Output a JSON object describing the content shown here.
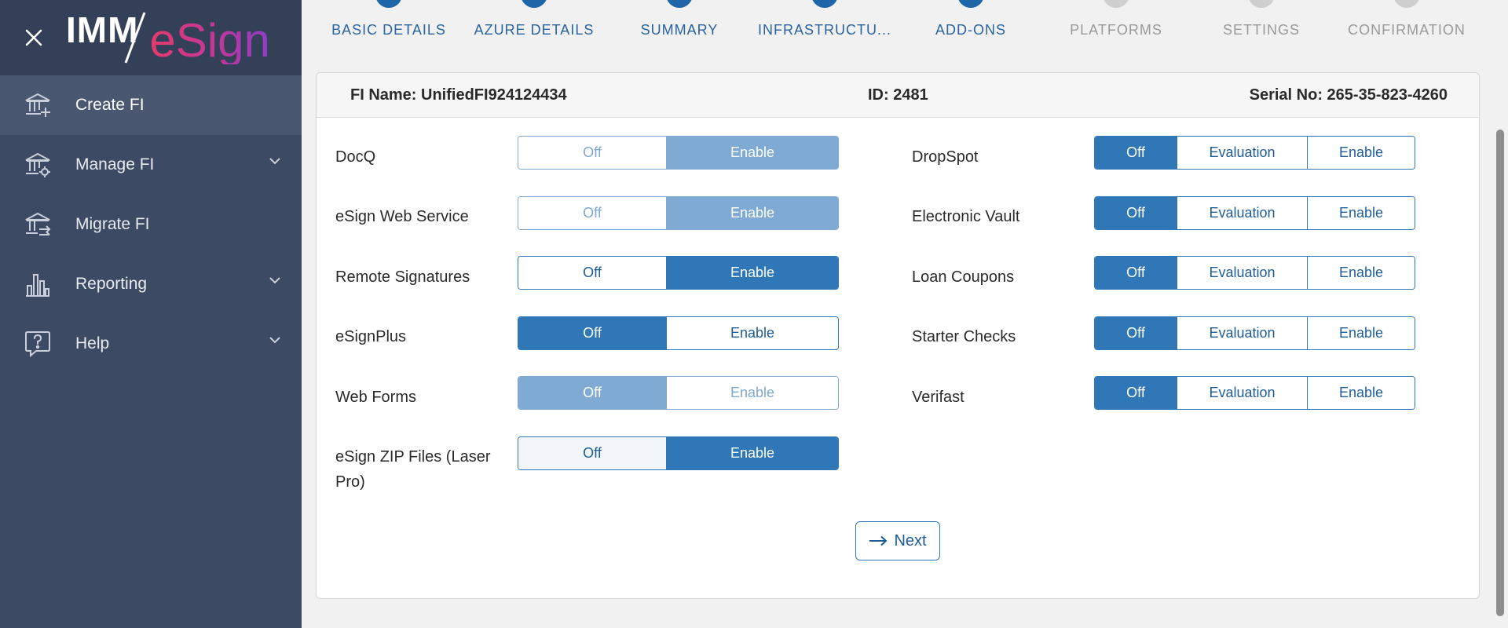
{
  "brand": {
    "logo_left": "IMM",
    "logo_right": "eSign"
  },
  "sidebar": {
    "items": [
      {
        "label": "Create FI",
        "icon": "bank-add-icon",
        "active": true
      },
      {
        "label": "Manage FI",
        "icon": "bank-settings-icon",
        "expandable": true
      },
      {
        "label": "Migrate FI",
        "icon": "bank-migrate-icon"
      },
      {
        "label": "Reporting",
        "icon": "bar-chart-icon",
        "expandable": true
      },
      {
        "label": "Help",
        "icon": "help-bubble-icon",
        "expandable": true
      }
    ]
  },
  "stepper": {
    "steps": [
      {
        "label": "BASIC DETAILS",
        "state": "done"
      },
      {
        "label": "AZURE DETAILS",
        "state": "done"
      },
      {
        "label": "SUMMARY",
        "state": "done"
      },
      {
        "label": "INFRASTRUCTU...",
        "state": "done"
      },
      {
        "label": "ADD-ONS",
        "state": "done"
      },
      {
        "label": "PLATFORMS",
        "state": "todo"
      },
      {
        "label": "SETTINGS",
        "state": "todo"
      },
      {
        "label": "CONFIRMATION",
        "state": "todo"
      }
    ]
  },
  "header": {
    "fi_name": "FI Name: UnifiedFI924124434",
    "id": "ID: 2481",
    "serial": "Serial No: 265-35-823-4260"
  },
  "options": {
    "off": "Off",
    "enable": "Enable",
    "evaluation": "Evaluation"
  },
  "left_addons": [
    {
      "label": "DocQ",
      "selected": "Enable",
      "disabled": true
    },
    {
      "label": "eSign Web Service",
      "selected": "Enable",
      "disabled": true
    },
    {
      "label": "Remote Signatures",
      "selected": "Enable",
      "disabled": false
    },
    {
      "label": "eSignPlus",
      "selected": "Off",
      "disabled": false
    },
    {
      "label": "Web Forms",
      "selected": "Off",
      "disabled": true
    },
    {
      "label": "eSign ZIP Files (Laser Pro)",
      "selected": "Enable",
      "disabled": false
    }
  ],
  "right_addons": [
    {
      "label": "DropSpot",
      "selected": "Off"
    },
    {
      "label": "Electronic Vault",
      "selected": "Off"
    },
    {
      "label": "Loan Coupons",
      "selected": "Off"
    },
    {
      "label": "Starter Checks",
      "selected": "Off"
    },
    {
      "label": "Verifast",
      "selected": "Off"
    }
  ],
  "next_button": {
    "label": "Next"
  },
  "colors": {
    "sidebar": "#3d4a63",
    "primary": "#2f77b6",
    "disabled_primary": "#7faad3"
  }
}
